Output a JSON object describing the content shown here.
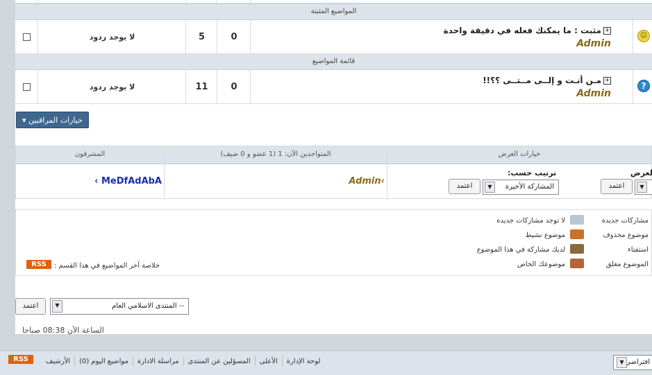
{
  "sticky_header": "المواضيع المثبتة",
  "list_header": "قائمة المواضيع",
  "threads": [
    {
      "title": "مثبت : ما يمكنك فعله في دقيقة واحدة",
      "author": "Admin",
      "views": "5",
      "replies": "0",
      "last_post": "لا يوجد ردود",
      "icon": "smiley-icon"
    },
    {
      "title": "مـن أنـت و إلــى مــتــى ؟؟!!",
      "author": "Admin",
      "views": "11",
      "replies": "0",
      "last_post": "لا يوجد ردود",
      "icon": "question-icon"
    }
  ],
  "mod_options": "خيارات المراقبين",
  "info": {
    "col_display": "خيارات العرض",
    "col_online": "المتواجدين الآن: 1 (1 عضو و 0 ضيف)",
    "col_mods": "المشرفون",
    "online_user": "Admin",
    "moderator": "MeDfAdAbA",
    "display_label": "العرض:",
    "sort_label": "ترتيب حسب:",
    "sort_value": "المشاركة الأخيرة",
    "submit": "اعتمد"
  },
  "legend": {
    "new_posts": "مشاركات جديدة",
    "no_new": "لا توجد مشاركات جديدة",
    "deleted": "موضوع محذوف",
    "active": "موضوع نشيط",
    "poll": "استفتاء",
    "you_posted": "لديك مشاركة في هذا الموضوع",
    "locked": "الموضوع مغلق",
    "your_topic": "موضوعك الخاص",
    "rss_text": "خلاصة آخر المواضيع في هذا القسم :",
    "rss": "RSS"
  },
  "jump": {
    "value": "-- المنتدى الاسلامي العام",
    "submit": "اعتمد"
  },
  "time": "الساعة الآن 08:38 صباحا",
  "footer": {
    "rss": "RSS",
    "admin": "لوحة الإدارة",
    "top": "الأعلى",
    "staff": "المسؤلين عن المنتدى",
    "contact": "مراسلة الادارة",
    "today": "مواضيع اليوم (0)",
    "archive": "الأرشيف",
    "style": "افتراضي"
  }
}
